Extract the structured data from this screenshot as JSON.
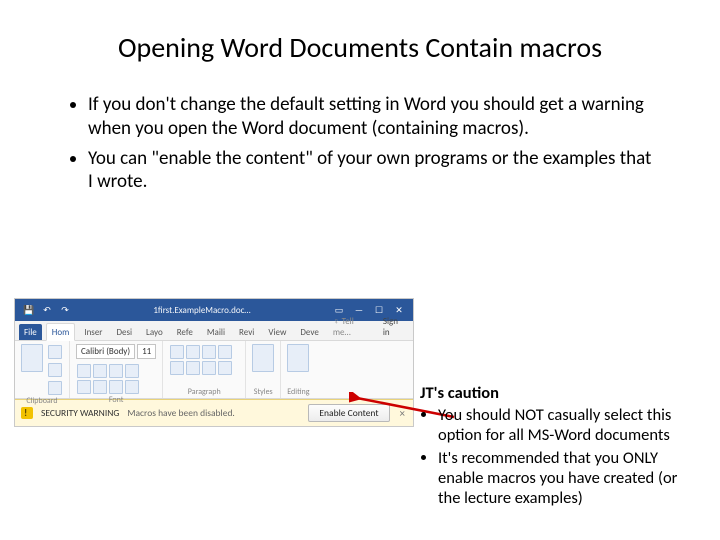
{
  "title": "Opening Word Documents Contain macros",
  "bullets": [
    "If you don't change the default setting in Word you should get a warning when you open the Word document (containing macros).",
    "You can \"enable the content\" of your own programs or the examples that I wrote."
  ],
  "word_ui": {
    "document_name": "1first.ExampleMacro.doc…",
    "tabs": {
      "file": "File",
      "home": "Hom",
      "insert": "Inser",
      "design": "Desi",
      "layout": "Layo",
      "references": "Refe",
      "mailings": "Maili",
      "review": "Revi",
      "view": "View",
      "developer": "Deve",
      "tell": "♀ Tell me…",
      "signin": "Sign in"
    },
    "font_name": "Calibri (Body)",
    "font_size": "11",
    "groups": {
      "clipboard": "Clipboard",
      "font": "Font",
      "paragraph": "Paragraph",
      "styles": "Styles",
      "editing": "Editing"
    },
    "security": {
      "label": "SECURITY WARNING",
      "message": "Macros have been disabled.",
      "button": "Enable Content"
    }
  },
  "caution": {
    "heading": "JT's caution",
    "items": [
      "You should NOT casually select this option for all MS-Word documents",
      "It's recommended that you ONLY enable macros you have created (or the lecture examples)"
    ]
  }
}
